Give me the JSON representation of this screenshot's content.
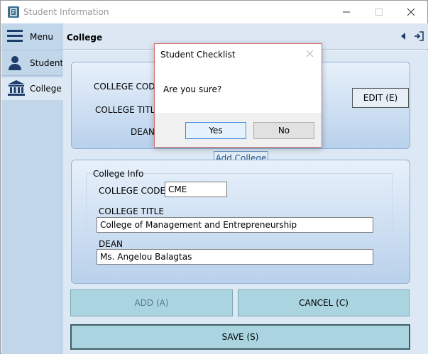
{
  "window": {
    "title": "Student Information"
  },
  "sidebar": {
    "items": [
      {
        "label": "Menu",
        "icon": "hamburger-icon"
      },
      {
        "label": "Student",
        "icon": "user-icon"
      },
      {
        "label": "College",
        "icon": "institution-icon"
      }
    ]
  },
  "header": {
    "title": "College"
  },
  "top_panel": {
    "college_code_label": "COLLEGE CODE",
    "college_title_label": "COLLEGE TITLE",
    "dean_label": "DEAN",
    "edit_label": "EDIT (E)"
  },
  "tab": {
    "label": "Add College"
  },
  "form": {
    "group_title": "College Info",
    "college_code_label": "COLLEGE CODE",
    "college_code_value": "CME",
    "college_title_label": "COLLEGE TITLE",
    "college_title_value": "College of Management and Entrepreneurship",
    "dean_label": "DEAN",
    "dean_value": "Ms. Angelou Balagtas"
  },
  "buttons": {
    "add": "ADD (A)",
    "cancel": "CANCEL (C)",
    "save": "SAVE (S)"
  },
  "dialog": {
    "title": "Student Checklist",
    "message": "Are you sure?",
    "yes": "Yes",
    "no": "No"
  },
  "colors": {
    "sidebar": "#c2d6ea",
    "button": "#a9d4e0",
    "accent": "#3c8cdc",
    "dialog_border": "#d56c6c"
  }
}
